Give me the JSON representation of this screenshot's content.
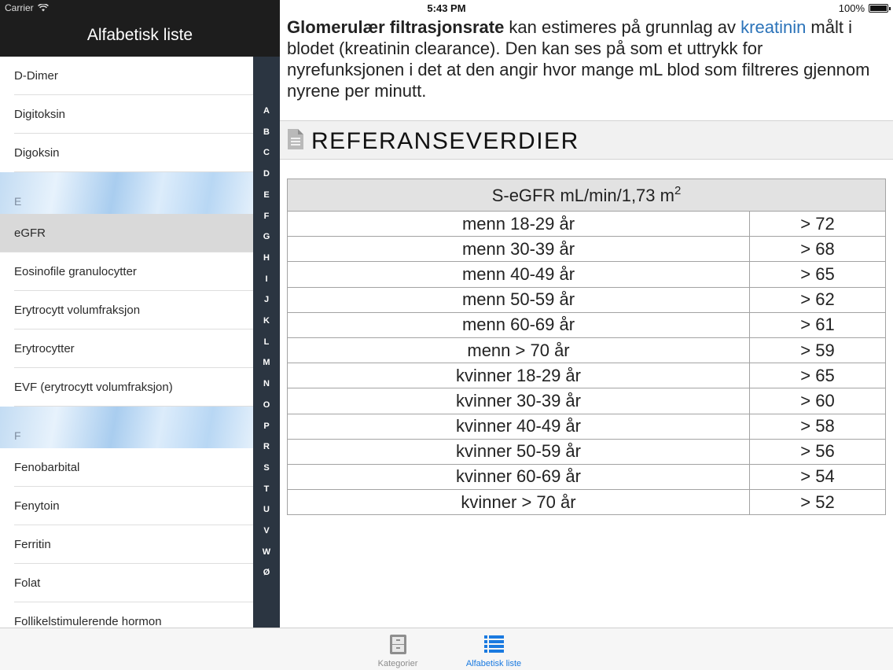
{
  "statusbar": {
    "carrier": "Carrier",
    "time": "5:43 PM",
    "battery": "100%"
  },
  "sidebar": {
    "title": "Alfabetisk liste",
    "items": [
      {
        "kind": "row",
        "label": "D-Dimer"
      },
      {
        "kind": "row",
        "label": "Digitoksin"
      },
      {
        "kind": "row",
        "label": "Digoksin"
      },
      {
        "kind": "section",
        "label": "E"
      },
      {
        "kind": "row",
        "label": "eGFR",
        "selected": true
      },
      {
        "kind": "row",
        "label": "Eosinofile granulocytter"
      },
      {
        "kind": "row",
        "label": "Erytrocytt volumfraksjon"
      },
      {
        "kind": "row",
        "label": "Erytrocytter"
      },
      {
        "kind": "row",
        "label": "EVF (erytrocytt volumfraksjon)"
      },
      {
        "kind": "section",
        "label": "F"
      },
      {
        "kind": "row",
        "label": "Fenobarbital"
      },
      {
        "kind": "row",
        "label": "Fenytoin"
      },
      {
        "kind": "row",
        "label": "Ferritin"
      },
      {
        "kind": "row",
        "label": "Folat"
      },
      {
        "kind": "row",
        "label": "Follikelstimulerende hormon"
      }
    ],
    "index_letters": [
      "A",
      "B",
      "C",
      "D",
      "E",
      "F",
      "G",
      "H",
      "I",
      "J",
      "K",
      "L",
      "M",
      "N",
      "O",
      "P",
      "R",
      "S",
      "T",
      "U",
      "V",
      "W",
      "Ø"
    ]
  },
  "content": {
    "intro_bold": "Glomerulær filtrasjonsrate",
    "intro_part1": " kan estimeres på grunnlag av ",
    "intro_link": "kreatinin",
    "intro_part2": " målt i blodet (kreatinin clearance). Den kan ses på som et uttrykk for nyrefunksjonen i det at den angir hvor mange mL blod som filtreres gjennom nyrene per minutt.",
    "section_title": "REFERANSEVERDIER",
    "table": {
      "header": "S-eGFR mL/min/1,73 m",
      "header_sup": "2",
      "rows": [
        {
          "group": "menn 18-29 år",
          "value": "> 72"
        },
        {
          "group": "menn 30-39 år",
          "value": "> 68"
        },
        {
          "group": "menn 40-49 år",
          "value": "> 65"
        },
        {
          "group": "menn 50-59 år",
          "value": "> 62"
        },
        {
          "group": "menn 60-69 år",
          "value": "> 61"
        },
        {
          "group": "menn > 70 år",
          "value": "> 59"
        },
        {
          "group": "kvinner 18-29 år",
          "value": "> 65"
        },
        {
          "group": "kvinner 30-39 år",
          "value": "> 60"
        },
        {
          "group": "kvinner 40-49 år",
          "value": "> 58"
        },
        {
          "group": "kvinner 50-59 år",
          "value": "> 56"
        },
        {
          "group": "kvinner 60-69 år",
          "value": "> 54"
        },
        {
          "group": "kvinner > 70 år",
          "value": "> 52"
        }
      ]
    }
  },
  "tabbar": {
    "tabs": [
      {
        "label": "Kategorier",
        "icon": "cabinet-icon",
        "active": false
      },
      {
        "label": "Alfabetisk liste",
        "icon": "list-icon",
        "active": true
      }
    ]
  },
  "colors": {
    "accent": "#1a7ae0",
    "link": "#2b73b9",
    "index_bar": "#2b3541",
    "nav_header": "#1d1d1d",
    "selected_row": "#d9d9d9"
  }
}
